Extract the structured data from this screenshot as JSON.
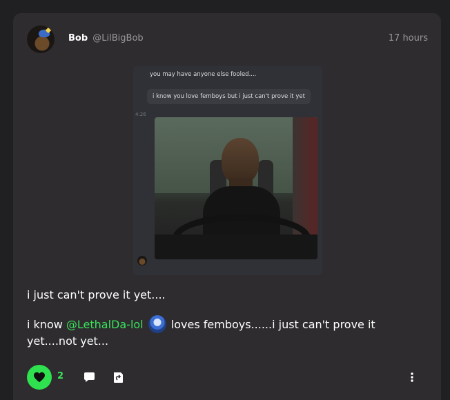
{
  "post": {
    "author_name": "Bob",
    "author_handle": "@LilBigBob",
    "timestamp": "17 hours",
    "media": {
      "messages": [
        "you may have anyone else fooled....",
        "i know you love femboys but i just can't prove it yet"
      ],
      "chat_time": "4:26"
    },
    "text_line1": "i just can't prove it yet....",
    "text_line2_prefix": "i know ",
    "text_line2_mention": "@LethalDa-lol",
    "text_line2_suffix": " loves femboys......i just can't prove it yet....not yet...",
    "like_count": "2"
  },
  "icons": {
    "like": "heart-icon",
    "comment": "comment-icon",
    "share": "share-icon",
    "more": "more-vertical-icon"
  },
  "colors": {
    "accent": "#2fe14f",
    "card": "#2e2c2f",
    "background": "#201f21"
  }
}
